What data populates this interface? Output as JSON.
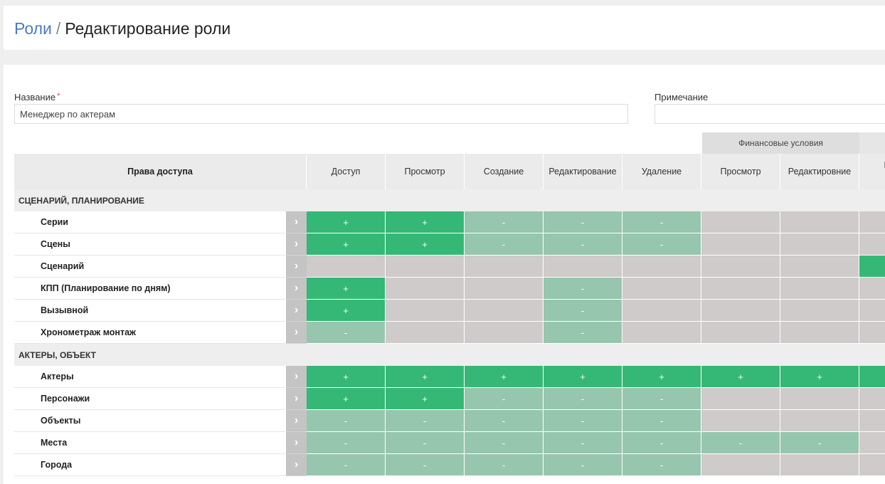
{
  "breadcrumb": {
    "parent": "Роли",
    "separator": "/",
    "current": "Редактирование роли"
  },
  "form": {
    "name_label": "Название",
    "required_mark": "*",
    "name_value": "Менеджер по актерам",
    "note_label": "Примечание",
    "note_value": ""
  },
  "table": {
    "group_header": "Финансовые условия",
    "name_header": "Права доступа",
    "columns": [
      "Доступ",
      "Просмотр",
      "Создание",
      "Редактирование",
      "Удаление",
      "Просмотр",
      "Редактировние",
      "Просмотр карточки"
    ],
    "symbols": {
      "plus": "+",
      "minus": "-",
      "none": ""
    },
    "sections": [
      {
        "title": "СЦЕНАРИЙ, ПЛАНИРОВАНИЕ",
        "rows": [
          {
            "name": "Серии",
            "cells": [
              "plus",
              "plus",
              "minus",
              "minus",
              "minus",
              "none",
              "none",
              "none"
            ]
          },
          {
            "name": "Сцены",
            "cells": [
              "plus",
              "plus",
              "minus",
              "minus",
              "minus",
              "none",
              "none",
              "none"
            ]
          },
          {
            "name": "Сценарий",
            "cells": [
              "none",
              "none",
              "none",
              "none",
              "none",
              "none",
              "none",
              "plus"
            ]
          },
          {
            "name": "КПП (Планирование по дням)",
            "cells": [
              "plus",
              "none",
              "none",
              "minus",
              "none",
              "none",
              "none",
              "none"
            ]
          },
          {
            "name": "Вызывной",
            "cells": [
              "plus",
              "none",
              "none",
              "minus",
              "none",
              "none",
              "none",
              "none"
            ]
          },
          {
            "name": "Хронометраж монтаж",
            "cells": [
              "minus",
              "none",
              "none",
              "minus",
              "none",
              "none",
              "none",
              "none"
            ]
          }
        ]
      },
      {
        "title": "АКТЕРЫ, ОБЪЕКТ",
        "rows": [
          {
            "name": "Актеры",
            "cells": [
              "plus",
              "plus",
              "plus",
              "plus",
              "plus",
              "plus",
              "plus",
              "plus"
            ]
          },
          {
            "name": "Персонажи",
            "cells": [
              "plus",
              "plus",
              "minus",
              "minus",
              "minus",
              "none",
              "none",
              "none"
            ]
          },
          {
            "name": "Объекты",
            "cells": [
              "minus",
              "minus",
              "minus",
              "minus",
              "minus",
              "none",
              "none",
              "none"
            ]
          },
          {
            "name": "Места",
            "cells": [
              "minus",
              "minus",
              "minus",
              "minus",
              "minus",
              "minus",
              "minus",
              "none"
            ]
          },
          {
            "name": "Города",
            "cells": [
              "minus",
              "minus",
              "minus",
              "minus",
              "minus",
              "none",
              "none",
              "none"
            ]
          }
        ]
      }
    ]
  },
  "icons": {
    "expand": "chevron-right-icon"
  },
  "colors": {
    "plus": "#35b875",
    "minus": "#97c6ae",
    "none": "#cfcbcb",
    "link": "#4a7bc2"
  }
}
